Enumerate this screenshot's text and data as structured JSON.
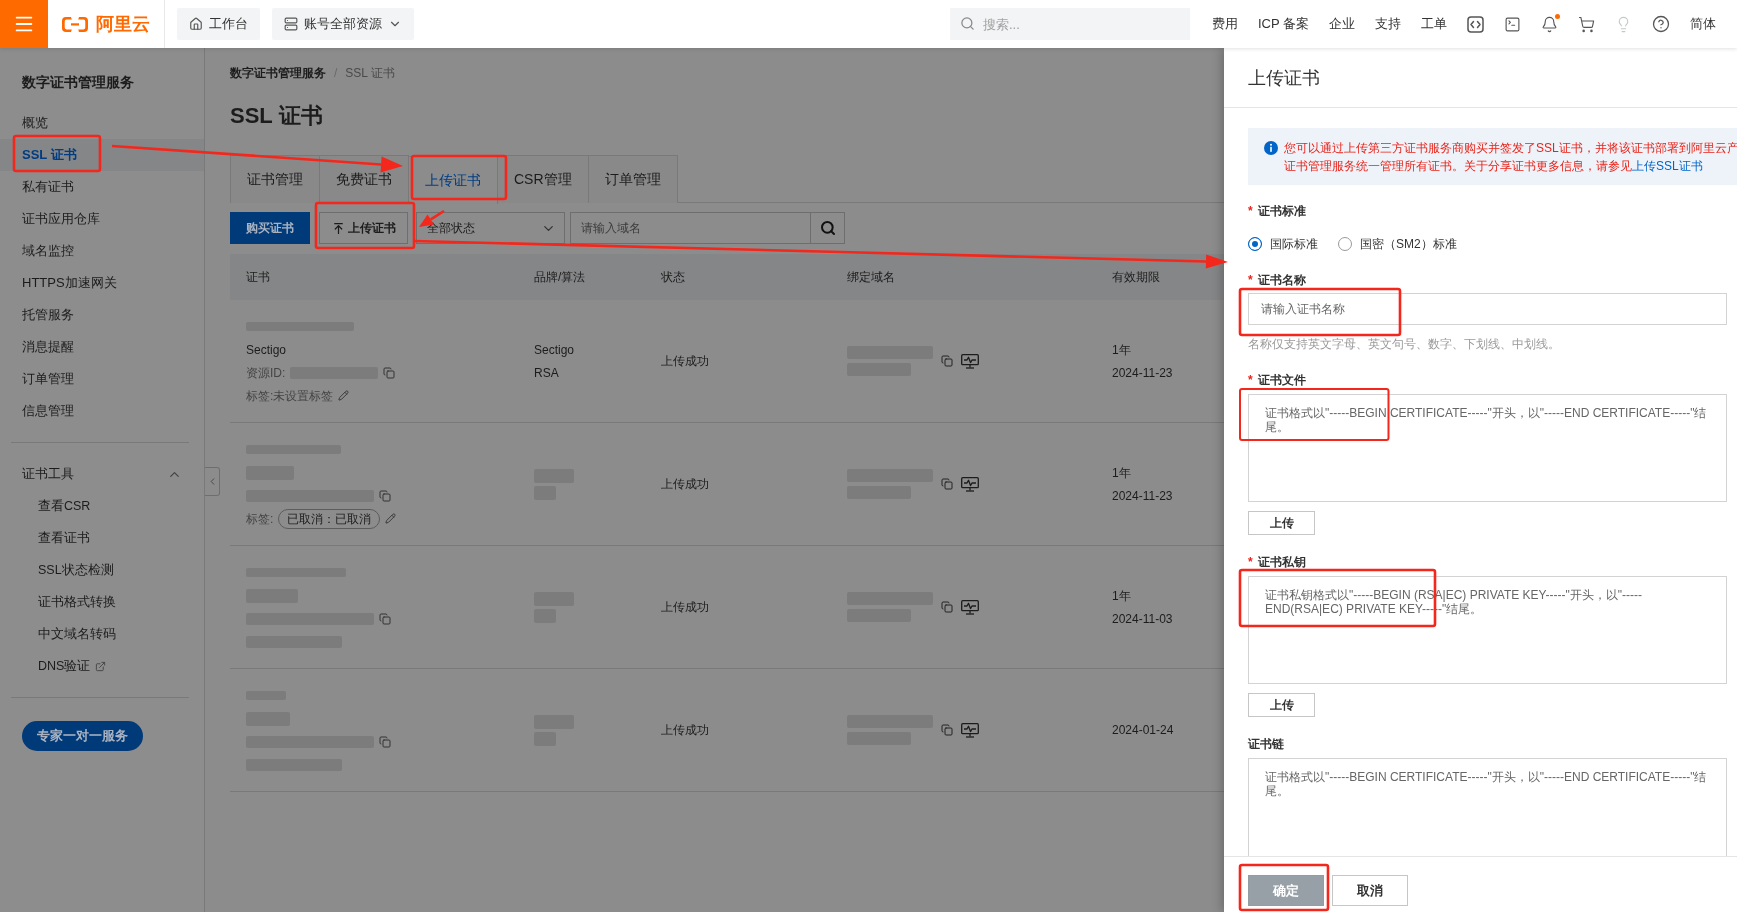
{
  "top_bar": {
    "logo_text": "阿里云",
    "workbench_button": "工作台",
    "resource_menu": "账号全部资源",
    "search": {
      "placeholder": "搜索..."
    },
    "links": [
      "费用",
      "ICP 备案",
      "企业",
      "支持",
      "工单"
    ],
    "notifications": {
      "unread": true
    },
    "language": "简体"
  },
  "sidebar": {
    "title": "数字证书管理服务",
    "items": [
      {
        "label": "概览",
        "selected": false
      },
      {
        "label": "SSL 证书",
        "selected": true
      },
      {
        "label": "私有证书",
        "selected": false
      },
      {
        "label": "证书应用仓库",
        "selected": false
      },
      {
        "label": "域名监控",
        "selected": false
      },
      {
        "label": "HTTPS加速网关",
        "selected": false
      },
      {
        "label": "托管服务",
        "selected": false
      },
      {
        "label": "消息提醒",
        "selected": false
      },
      {
        "label": "订单管理",
        "selected": false
      },
      {
        "label": "信息管理",
        "selected": false
      }
    ],
    "tool_group": {
      "label": "证书工具",
      "expanded": true,
      "children": [
        {
          "label": "查看CSR",
          "selected": false,
          "external": false
        },
        {
          "label": "查看证书",
          "selected": false,
          "external": false
        },
        {
          "label": "SSL状态检测",
          "selected": false,
          "external": false
        },
        {
          "label": "证书格式转换",
          "selected": false,
          "external": false
        },
        {
          "label": "中文域名转码",
          "selected": false,
          "external": false
        },
        {
          "label": "DNS验证",
          "selected": false,
          "external": true
        }
      ]
    },
    "expert_button": "专家一对一服务"
  },
  "breadcrumb": {
    "items": [
      "数字证书管理服务",
      "SSL 证书"
    ],
    "separator": "/"
  },
  "page_title": "SSL 证书",
  "tabs": [
    {
      "label": "证书管理",
      "selected": false
    },
    {
      "label": "免费证书",
      "selected": false
    },
    {
      "label": "上传证书",
      "selected": true
    },
    {
      "label": "CSR管理",
      "selected": false
    },
    {
      "label": "订单管理",
      "selected": false
    }
  ],
  "toolbar": {
    "buy_button": "购买证书",
    "upload_button": "上传证书",
    "status_filter": "全部状态",
    "domain_search": {
      "placeholder": "请输入域名"
    }
  },
  "table": {
    "columns": [
      "证书",
      "品牌/算法",
      "状态",
      "绑定域名",
      "有效期限"
    ],
    "rows": [
      {
        "certificate": {
          "name": "Sectigo",
          "resource_id_label": "资源ID:",
          "tag_label": "标签:未设置标签"
        },
        "brand": "Sectigo",
        "algorithm": "RSA",
        "status": "上传成功",
        "validity": "1年",
        "expires": "2024-11-23"
      },
      {
        "certificate": {
          "tag_label": "标签:",
          "tag": "已取消：已取消"
        },
        "status": "上传成功",
        "validity": "1年",
        "expires": "2024-11-23"
      },
      {
        "status": "上传成功",
        "validity": "1年",
        "expires": "2024-11-03"
      },
      {
        "status": "上传成功",
        "expires": "2024-01-24"
      }
    ]
  },
  "drawer": {
    "title": "上传证书",
    "notice": {
      "text": "您可以通过上传第三方证书服务商购买并签发了SSL证书，并将该证书部署到阿里云产",
      "text_2": "证书管理服务统一管理所有证书。关于分享证书更多信息，请参见",
      "link": "上传SSL证书"
    },
    "fields": [
      {
        "kind": "radio",
        "required_mark": "*",
        "label": "证书标准",
        "options": [
          {
            "label": "国际标准",
            "selected": true
          },
          {
            "label": "国密（SM2）标准",
            "selected": false
          }
        ]
      },
      {
        "kind": "input",
        "required_mark": "*",
        "label": "证书名称",
        "placeholder": "请输入证书名称",
        "help": "名称仅支持英文字母、英文句号、数字、下划线、中划线。"
      },
      {
        "kind": "textarea",
        "required_mark": "*",
        "label": "证书文件",
        "placeholder": "证书格式以\"-----BEGIN CERTIFICATE-----\"开头，以\"-----END CERTIFICATE-----\"结尾。",
        "upload_button": "上传"
      },
      {
        "kind": "textarea",
        "required_mark": "*",
        "label": "证书私钥",
        "placeholder": "证书私钥格式以\"-----BEGIN (RSA|EC) PRIVATE KEY-----\"开头，以\"-----END(RSA|EC) PRIVATE KEY-----\"结尾。",
        "upload_button": "上传"
      },
      {
        "kind": "textarea",
        "label": "证书链",
        "placeholder": "证书格式以\"-----BEGIN CERTIFICATE-----\"开头，以\"-----END CERTIFICATE-----\"结尾。"
      }
    ],
    "buttons": [
      {
        "label": "确定",
        "kind": "primary",
        "disabled": true
      },
      {
        "label": "取消",
        "kind": "default",
        "disabled": false
      }
    ]
  }
}
